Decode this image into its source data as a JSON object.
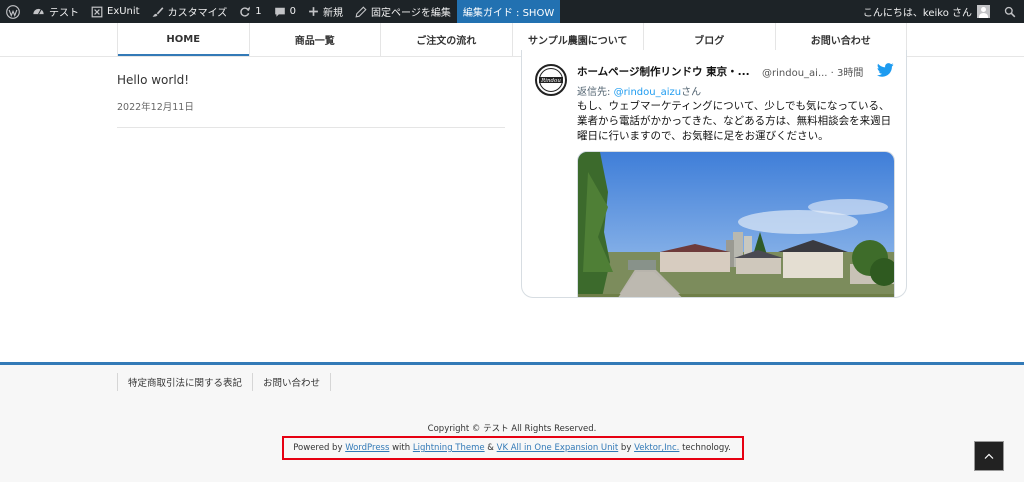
{
  "admin_bar": {
    "site_name": "テスト",
    "exunit": "ExUnit",
    "customize": "カスタマイズ",
    "updates_count": "1",
    "comments_count": "0",
    "new_label": "新規",
    "edit_page": "固定ページを編集",
    "edit_guide": "編集ガイド : SHOW",
    "greeting": "こんにちは、keiko さん",
    "icons": [
      "wordpress-logo-icon",
      "dashboard-icon",
      "exunit-icon",
      "brush-icon",
      "update-icon",
      "comment-icon",
      "plus-icon",
      "pencil-icon",
      "avatar-icon",
      "search-icon"
    ],
    "accent": "#2271b1"
  },
  "nav": {
    "items": [
      "HOME",
      "商品一覧",
      "ご注文の流れ",
      "サンプル農園について",
      "ブログ",
      "お問い合わせ"
    ],
    "active": "HOME",
    "accent": "#337ab7"
  },
  "post": {
    "title": "Hello world!",
    "date": "2022年12月11日"
  },
  "tweet": {
    "name": "ホームページ制作リンドウ 東京・...",
    "handle": "@rindou_ai...",
    "time": "· 3時間",
    "reply_prefix": "返信先: ",
    "reply_mention": "@rindou_aizu",
    "reply_suffix": "さん",
    "text": "もし、ウェブマーケティングについて、少しでも気になっている、業者から電話がかかってきた、などある方は、無料相談会を来週日曜日に行いますので、お気軽に足をお運びください。",
    "avatar_text": "Rindou",
    "twitter_color": "#1d9bf0"
  },
  "footer": {
    "nav_items": [
      "特定商取引法に関する表記",
      "お問い合わせ"
    ],
    "copyright": "Copyright © テスト All Rights Reserved.",
    "powered": {
      "prefix": "Powered by ",
      "wordpress": "WordPress",
      "with": " with ",
      "lightning": "Lightning Theme",
      "amp": " & ",
      "vk": "VK All in One Expansion Unit",
      "by": " by ",
      "vektor": "Vektor,Inc.",
      "suffix": " technology."
    },
    "highlight_color": "#e60012"
  }
}
